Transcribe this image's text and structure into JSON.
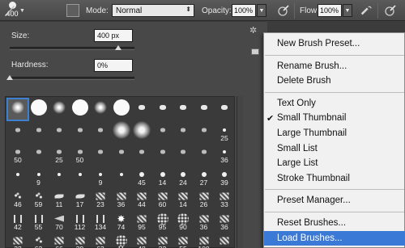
{
  "options_bar": {
    "brush_size": "400",
    "mode_label": "Mode:",
    "mode_value": "Normal",
    "opacity_label": "Opacity:",
    "opacity_value": "100%",
    "flow_label": "Flow:",
    "flow_value": "100%",
    "icons": [
      "brush-tool-icon",
      "chevron-down-icon",
      "brush-panel-toggle-icon",
      "pressure-opacity-icon",
      "airbrush-icon",
      "pressure-size-icon"
    ]
  },
  "brush_panel": {
    "size_label": "Size:",
    "size_value": "400 px",
    "size_slider_fraction": 0.87,
    "hardness_label": "Hardness:",
    "hardness_value": "0%",
    "hardness_slider_fraction": 0.0,
    "icons": [
      "gear-icon",
      "new-preset-icon"
    ],
    "brushes": [
      {
        "shape": "soft",
        "label": "",
        "selected": true
      },
      {
        "shape": "hard",
        "label": ""
      },
      {
        "shape": "soft",
        "label": ""
      },
      {
        "shape": "hard",
        "label": ""
      },
      {
        "shape": "soft",
        "label": ""
      },
      {
        "shape": "hard",
        "label": ""
      },
      {
        "shape": "blob",
        "label": ""
      },
      {
        "shape": "blob",
        "label": ""
      },
      {
        "shape": "blob",
        "label": ""
      },
      {
        "shape": "blob",
        "label": ""
      },
      {
        "shape": "blob",
        "label": ""
      },
      {
        "shape": "sblob",
        "label": ""
      },
      {
        "shape": "sblob",
        "label": ""
      },
      {
        "shape": "sblob",
        "label": ""
      },
      {
        "shape": "sblob",
        "label": ""
      },
      {
        "shape": "sblob",
        "label": ""
      },
      {
        "shape": "bigsoft",
        "label": ""
      },
      {
        "shape": "bigsoft",
        "label": ""
      },
      {
        "shape": "sblob",
        "label": ""
      },
      {
        "shape": "sblob",
        "label": ""
      },
      {
        "shape": "sblob",
        "label": ""
      },
      {
        "shape": "sdot",
        "label": "25"
      },
      {
        "shape": "sblob",
        "label": "50"
      },
      {
        "shape": "sblob",
        "label": ""
      },
      {
        "shape": "sblob",
        "label": "25"
      },
      {
        "shape": "sblob",
        "label": "50"
      },
      {
        "shape": "sblob",
        "label": ""
      },
      {
        "shape": "sblob",
        "label": ""
      },
      {
        "shape": "sblob",
        "label": ""
      },
      {
        "shape": "sblob",
        "label": ""
      },
      {
        "shape": "sblob",
        "label": ""
      },
      {
        "shape": "sblob",
        "label": ""
      },
      {
        "shape": "sdot",
        "label": "36"
      },
      {
        "shape": "sdot",
        "label": ""
      },
      {
        "shape": "sdot",
        "label": "9"
      },
      {
        "shape": "sdot",
        "label": ""
      },
      {
        "shape": "sdot",
        "label": ""
      },
      {
        "shape": "sdot",
        "label": "9"
      },
      {
        "shape": "sdot",
        "label": ""
      },
      {
        "shape": "dot",
        "label": "45"
      },
      {
        "shape": "dot",
        "label": "14"
      },
      {
        "shape": "dot",
        "label": "24"
      },
      {
        "shape": "dot",
        "label": "27"
      },
      {
        "shape": "dot",
        "label": "39"
      },
      {
        "shape": "speck",
        "label": "46"
      },
      {
        "shape": "speck",
        "label": "59"
      },
      {
        "shape": "leaf",
        "label": "11"
      },
      {
        "shape": "leaf",
        "label": "17"
      },
      {
        "shape": "tex",
        "label": "23"
      },
      {
        "shape": "tex",
        "label": "36"
      },
      {
        "shape": "tex",
        "label": "44"
      },
      {
        "shape": "tex",
        "label": "60"
      },
      {
        "shape": "tex",
        "label": "14"
      },
      {
        "shape": "tex",
        "label": "26"
      },
      {
        "shape": "tex",
        "label": "33"
      },
      {
        "shape": "grass",
        "label": "42"
      },
      {
        "shape": "grass",
        "label": "55"
      },
      {
        "shape": "fan",
        "label": "70"
      },
      {
        "shape": "grass",
        "label": "112"
      },
      {
        "shape": "grass",
        "label": "134"
      },
      {
        "shape": "star",
        "label": "74"
      },
      {
        "shape": "tex",
        "label": "95"
      },
      {
        "shape": "spray",
        "label": "95"
      },
      {
        "shape": "spray",
        "label": "90"
      },
      {
        "shape": "tex",
        "label": "36"
      },
      {
        "shape": "tex",
        "label": "36"
      },
      {
        "shape": "tex",
        "label": "33"
      },
      {
        "shape": "speck",
        "label": "63"
      },
      {
        "shape": "tex",
        "label": "66"
      },
      {
        "shape": "tex",
        "label": "39"
      },
      {
        "shape": "tex",
        "label": "63"
      },
      {
        "shape": "spray",
        "label": "11"
      },
      {
        "shape": "tex",
        "label": "48"
      },
      {
        "shape": "tex",
        "label": "32"
      },
      {
        "shape": "tex",
        "label": "55"
      },
      {
        "shape": "tex",
        "label": "100"
      },
      {
        "shape": "tex",
        "label": ""
      }
    ]
  },
  "menu": {
    "items": [
      {
        "label": "New Brush Preset..."
      },
      {
        "sep": true
      },
      {
        "label": "Rename Brush..."
      },
      {
        "label": "Delete Brush"
      },
      {
        "sep": true
      },
      {
        "label": "Text Only"
      },
      {
        "label": "Small Thumbnail",
        "checked": true
      },
      {
        "label": "Large Thumbnail"
      },
      {
        "label": "Small List"
      },
      {
        "label": "Large List"
      },
      {
        "label": "Stroke Thumbnail"
      },
      {
        "sep": true
      },
      {
        "label": "Preset Manager..."
      },
      {
        "sep": true
      },
      {
        "label": "Reset Brushes..."
      },
      {
        "label": "Load Brushes...",
        "highlighted": true
      }
    ],
    "check_mark": "✔",
    "highlight_color": "#3b79d6"
  }
}
